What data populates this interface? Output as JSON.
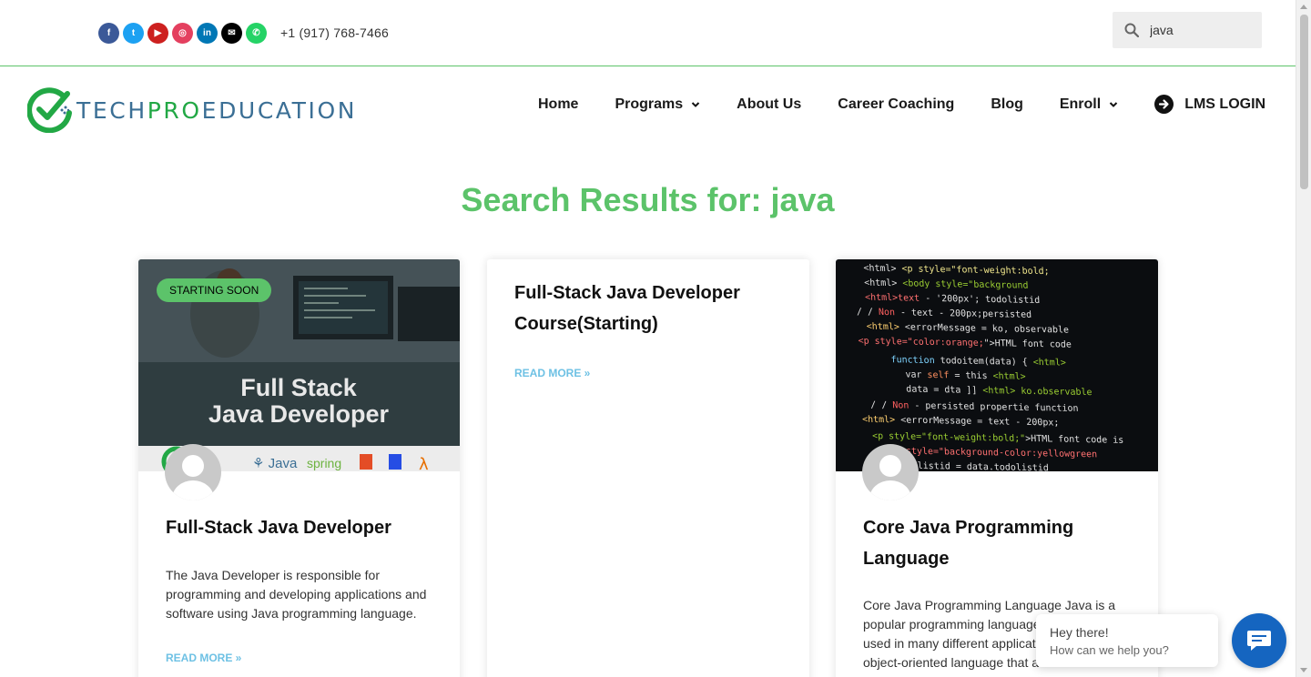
{
  "topbar": {
    "socials": [
      {
        "name": "facebook-icon",
        "color": "#3b5998",
        "glyph": "f"
      },
      {
        "name": "twitter-icon",
        "color": "#1da1f2",
        "glyph": "t"
      },
      {
        "name": "youtube-icon",
        "color": "#cd201f",
        "glyph": "▶"
      },
      {
        "name": "instagram-icon",
        "color": "#e4405f",
        "glyph": "◎"
      },
      {
        "name": "linkedin-icon",
        "color": "#0077b5",
        "glyph": "in"
      },
      {
        "name": "email-icon",
        "color": "#000000",
        "glyph": "✉"
      },
      {
        "name": "whatsapp-icon",
        "color": "#25d366",
        "glyph": "✆"
      }
    ],
    "phone": "+1 (917) 768-7466",
    "search_value": "java"
  },
  "header": {
    "logo_part1": "TECH",
    "logo_part2": "PRO",
    "logo_part3": "EDUCATION",
    "nav": {
      "home": "Home",
      "programs": "Programs",
      "about": "About Us",
      "career": "Career Coaching",
      "blog": "Blog",
      "enroll": "Enroll",
      "lms": "LMS LOGIN"
    }
  },
  "page_title": "Search Results for: java",
  "cards": [
    {
      "badge": "STARTING SOON",
      "thumb_line1": "Full Stack",
      "thumb_line2": "Java Developer",
      "thumb_logos": "Java",
      "title": "Full-Stack Java Developer",
      "excerpt_line1": "The Java Developer is responsible for",
      "excerpt_line2": "programming and developing applications and",
      "excerpt_line3": "software using Java programming language.",
      "read_more": "READ MORE »"
    },
    {
      "title_line1": "Full-Stack Java Developer",
      "title_line2": "Course(Starting)",
      "read_more": "READ MORE »"
    },
    {
      "title_line1": "Core Java Programming",
      "title_line2": "Language",
      "excerpt_line1": "Core Java Programming Language Java is a",
      "excerpt_line2": "popular programming language",
      "excerpt_line3": "used in many different applicat",
      "excerpt_line4": "object-oriented language that a"
    }
  ],
  "chat": {
    "greeting": "Hey there!",
    "prompt": "How can we help you?"
  },
  "colors": {
    "accent_green": "#5cc36a",
    "link_blue": "#6ec1e4",
    "chat_blue": "#1565c0"
  }
}
